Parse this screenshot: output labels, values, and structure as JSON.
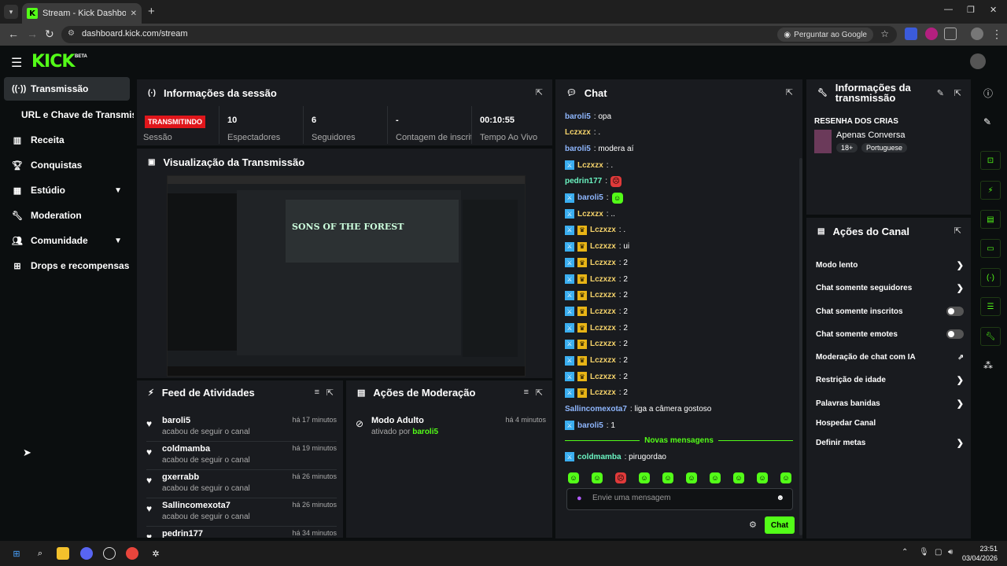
{
  "browser": {
    "tab_title": "Stream - Kick Dashboard",
    "url": "dashboard.kick.com/stream",
    "ask_google": "Perguntar ao Google"
  },
  "header": {
    "logo": "KICK",
    "beta": "BETA"
  },
  "sidebar": {
    "items": [
      {
        "label": "Transmissão",
        "icon": "broadcast-icon"
      },
      {
        "label": "URL e Chave de Transmissão"
      },
      {
        "label": "Receita",
        "icon": "revenue-icon"
      },
      {
        "label": "Conquistas",
        "icon": "trophy-icon"
      },
      {
        "label": "Estúdio",
        "icon": "studio-icon"
      },
      {
        "label": "Moderation",
        "icon": "wrench-icon"
      },
      {
        "label": "Comunidade",
        "icon": "community-icon"
      },
      {
        "label": "Drops e recompensas",
        "icon": "drops-icon"
      }
    ]
  },
  "session": {
    "title": "Informações da sessão",
    "live_badge": "TRANSMITINDO",
    "session_label": "Sessão",
    "stats": [
      {
        "value": "10",
        "label": "Espectadores"
      },
      {
        "value": "6",
        "label": "Seguidores"
      },
      {
        "value": "-",
        "label": "Contagem de inscritos"
      },
      {
        "value": "00:10:55",
        "label": "Tempo Ao Vivo"
      }
    ]
  },
  "preview": {
    "title": "Visualização da Transmissão",
    "game_title": "SONS OF THE FOREST"
  },
  "feed": {
    "title": "Feed de Atividades",
    "items": [
      {
        "name": "baroli5",
        "action": "acabou de seguir o canal",
        "time": "há 17 minutos"
      },
      {
        "name": "coldmamba",
        "action": "acabou de seguir o canal",
        "time": "há 19 minutos"
      },
      {
        "name": "gxerrabb",
        "action": "acabou de seguir o canal",
        "time": "há 26 minutos"
      },
      {
        "name": "Sallincomexota7",
        "action": "acabou de seguir o canal",
        "time": "há 26 minutos"
      },
      {
        "name": "pedrin177",
        "action": "",
        "time": "há 34 minutos"
      }
    ]
  },
  "moderation": {
    "title": "Ações de Moderação",
    "items": [
      {
        "title": "Modo Adulto",
        "by_prefix": "ativado por",
        "by": "baroli5",
        "time": "há 4 minutos"
      }
    ]
  },
  "chat": {
    "title": "Chat",
    "messages": [
      {
        "user": "baroli5",
        "text": ": opa",
        "color": "#8fb7ff",
        "badges": []
      },
      {
        "user": "Lczxzx",
        "text": ": .",
        "color": "#f5d36b",
        "badges": []
      },
      {
        "user": "baroli5",
        "text": ": modera aí",
        "color": "#8fb7ff",
        "badges": []
      },
      {
        "user": "Lczxzx",
        "text": ": .",
        "color": "#f5d36b",
        "badges": [
          "mod"
        ]
      },
      {
        "user": "pedrin177",
        "text": ":",
        "color": "#6bf5c2",
        "badges": [],
        "emote": "red"
      },
      {
        "user": "baroli5",
        "text": ":",
        "color": "#8fb7ff",
        "badges": [
          "mod"
        ],
        "emote": "green"
      },
      {
        "user": "Lczxzx",
        "text": ": ..",
        "color": "#f5d36b",
        "badges": [
          "mod"
        ]
      },
      {
        "user": "Lczxzx",
        "text": ": .",
        "color": "#f5d36b",
        "badges": [
          "mod",
          "vip"
        ]
      },
      {
        "user": "Lczxzx",
        "text": ": ui",
        "color": "#f5d36b",
        "badges": [
          "mod",
          "vip"
        ]
      },
      {
        "user": "Lczxzx",
        "text": ": 2",
        "color": "#f5d36b",
        "badges": [
          "mod",
          "vip"
        ]
      },
      {
        "user": "Lczxzx",
        "text": ": 2",
        "color": "#f5d36b",
        "badges": [
          "mod",
          "vip"
        ]
      },
      {
        "user": "Lczxzx",
        "text": ": 2",
        "color": "#f5d36b",
        "badges": [
          "mod",
          "vip"
        ]
      },
      {
        "user": "Lczxzx",
        "text": ": 2",
        "color": "#f5d36b",
        "badges": [
          "mod",
          "vip"
        ]
      },
      {
        "user": "Lczxzx",
        "text": ": 2",
        "color": "#f5d36b",
        "badges": [
          "mod",
          "vip"
        ]
      },
      {
        "user": "Lczxzx",
        "text": ": 2",
        "color": "#f5d36b",
        "badges": [
          "mod",
          "vip"
        ]
      },
      {
        "user": "Lczxzx",
        "text": ": 2",
        "color": "#f5d36b",
        "badges": [
          "mod",
          "vip"
        ]
      },
      {
        "user": "Lczxzx",
        "text": ": 2",
        "color": "#f5d36b",
        "badges": [
          "mod",
          "vip"
        ]
      },
      {
        "user": "Lczxzx",
        "text": ": 2",
        "color": "#f5d36b",
        "badges": [
          "mod",
          "vip"
        ]
      },
      {
        "user": "Sallincomexota7",
        "text": ": liga a câmera gostoso",
        "color": "#8fb7ff",
        "badges": []
      },
      {
        "user": "baroli5",
        "text": ": 1",
        "color": "#8fb7ff",
        "badges": [
          "mod"
        ]
      }
    ],
    "new_messages": "Novas mensagens",
    "after_new": {
      "user": "coldmamba",
      "text": ": pirugordao",
      "color": "#6bf5c2"
    },
    "placeholder": "Envie uma mensagem",
    "send_label": "Chat"
  },
  "stream_info": {
    "title": "Informações da transmissão",
    "stream_title": "RESENHA DOS CRIAS",
    "category": "Apenas Conversa",
    "tags": [
      "18+",
      "Portuguese"
    ]
  },
  "channel_actions": {
    "title": "Ações do Canal",
    "items": [
      {
        "label": "Modo lento",
        "kind": "chevron"
      },
      {
        "label": "Chat somente seguidores",
        "kind": "chevron"
      },
      {
        "label": "Chat somente inscritos",
        "kind": "toggle"
      },
      {
        "label": "Chat somente emotes",
        "kind": "toggle"
      },
      {
        "label": "Moderação de chat com IA",
        "kind": "external"
      },
      {
        "label": "Restrição de idade",
        "kind": "chevron"
      },
      {
        "label": "Palavras banidas",
        "kind": "chevron"
      },
      {
        "label": "Hospedar Canal",
        "kind": "none"
      },
      {
        "label": "Definir metas",
        "kind": "chevron"
      }
    ]
  },
  "taskbar": {
    "time": "23:51",
    "date": "03/04/2026"
  },
  "colors": {
    "accent": "#53fc18",
    "live": "#e0161b",
    "panel": "#191b1f"
  }
}
